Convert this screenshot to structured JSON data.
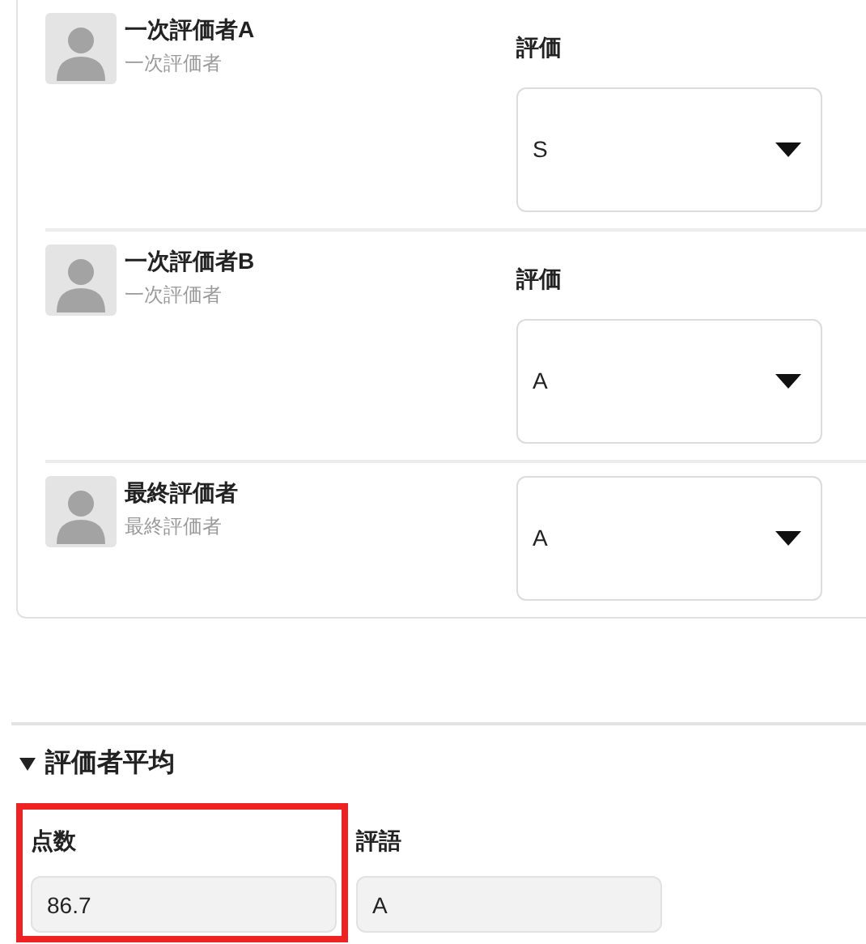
{
  "evaluators": [
    {
      "name": "一次評価者A",
      "role": "一次評価者",
      "rating_label": "評価",
      "rating": "S"
    },
    {
      "name": "一次評価者B",
      "role": "一次評価者",
      "rating_label": "評価",
      "rating": "A"
    },
    {
      "name": "最終評価者",
      "role": "最終評価者",
      "rating": "A"
    }
  ],
  "average": {
    "title": "評価者平均",
    "expanded": true,
    "fields": [
      {
        "label": "点数",
        "value": "86.7",
        "highlighted": true
      },
      {
        "label": "評語",
        "value": "A",
        "highlighted": false
      }
    ]
  }
}
